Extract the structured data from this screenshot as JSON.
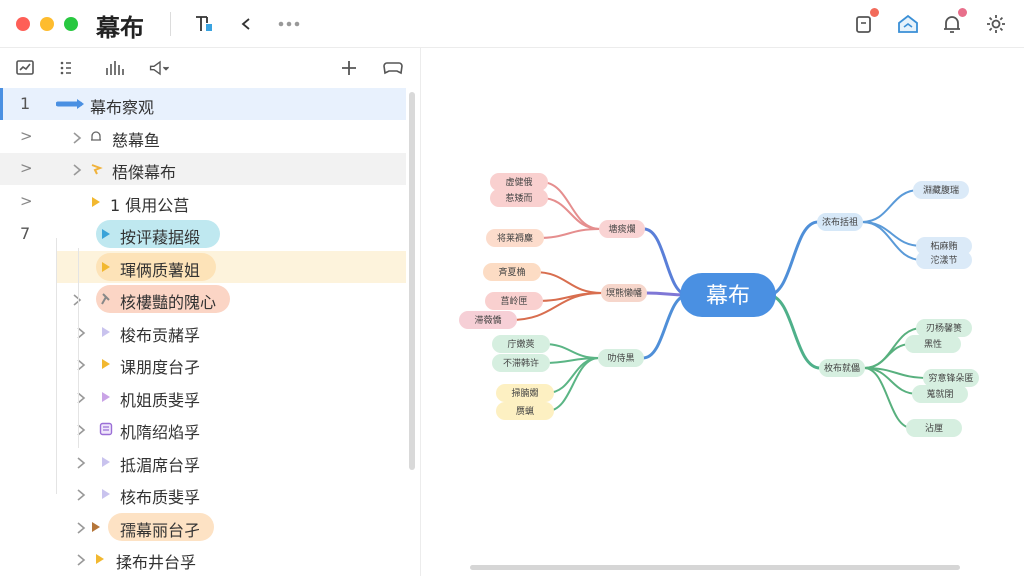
{
  "app": {
    "title": "幕布"
  },
  "titlebar_icons": [
    "document-link-icon",
    "collapse-arrows-icon",
    "more-dots-icon"
  ],
  "right_icons": [
    "tablet-icon",
    "home-share-icon",
    "bell-icon",
    "gear-icon"
  ],
  "colors": {
    "accent": "#4a90e2",
    "row_highlight": "#e8f1fd",
    "pill_blue": "#bfe8f0",
    "pill_yellow": "#fdf0d0",
    "pill_orange": "#fbd9c4",
    "pill_peach": "#fde3c8"
  },
  "toolbar": {
    "icons": [
      "chart-icon",
      "list-icon",
      "bars-icon",
      "megaphone-icon",
      "plus-icon",
      "gamepad-icon"
    ]
  },
  "outline": {
    "rows": [
      {
        "num": "1",
        "label": "幕布察观",
        "icon": "arrow-icon"
      },
      {
        "num": ">",
        "label": "慈幕鱼",
        "icon": "bell-outline-icon"
      },
      {
        "num": ">",
        "label": "梧傑幕布",
        "icon": "flag-icon"
      },
      {
        "num": ">",
        "label": "1 俱用公莒",
        "icon": "triangle-icon"
      },
      {
        "num": "7",
        "label": "按评薐据缎",
        "icon": "triangle-icon"
      },
      {
        "num": "",
        "label": "琿俩质薯姐",
        "icon": "triangle-icon"
      },
      {
        "num": "",
        "label": "核樓豔的隗心",
        "icon": "pin-icon"
      },
      {
        "num": "",
        "label": "梭布贡赭孚",
        "icon": "triangle-icon"
      },
      {
        "num": "",
        "label": "课朋度台孑",
        "icon": "triangle-icon"
      },
      {
        "num": "",
        "label": "机姐质斐孚",
        "icon": "triangle-icon"
      },
      {
        "num": "",
        "label": "机隋绍焰孚",
        "icon": "note-icon"
      },
      {
        "num": "",
        "label": "抵湄席台孚",
        "icon": "triangle-icon"
      },
      {
        "num": "",
        "label": "核布质斐孚",
        "icon": "triangle-icon"
      },
      {
        "num": "",
        "label": "孺幕丽台孑",
        "icon": "triangle-icon"
      },
      {
        "num": "",
        "label": "揉布井台孚",
        "icon": "triangle-icon"
      }
    ]
  },
  "mindmap": {
    "center": "幕布",
    "left": [
      {
        "label": "塘痰爛",
        "children": [
          "虚健俄",
          "惹矮而",
          "将莱褥麋"
        ]
      },
      {
        "label": "塓熊懒幡",
        "children": [
          "斉夏桷",
          "莒岭匣",
          "滞薇僑"
        ]
      },
      {
        "label": "叻侍黒",
        "children": [
          "庁嫩莢",
          "不滞韩许",
          "掃腩嫺",
          "赝蝋"
        ]
      }
    ],
    "right": [
      {
        "label": "浓布括祖",
        "children": [
          "淵藏腹瑞",
          "柘麻贿",
          "沱漾节"
        ]
      },
      {
        "label": "枚布就儡",
        "children": [
          "刃杨馨篑",
          "黑性",
          "穷意锋朵匿",
          "蒐就閉",
          "沾厘"
        ]
      }
    ]
  }
}
